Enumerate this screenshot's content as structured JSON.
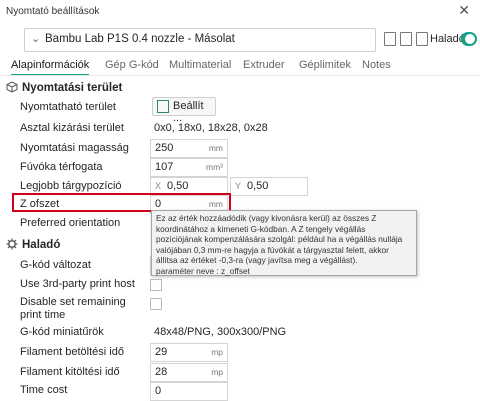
{
  "window": {
    "title": "Nyomtató beállítások",
    "close_glyph": "✕"
  },
  "preset": {
    "name": "Bambu Lab P1S 0.4 nozzle - Másolat",
    "advanced_label": "Haladó",
    "advanced_on": true
  },
  "tabs": [
    {
      "label": "Alapinformációk",
      "active": true
    },
    {
      "label": "Gép G-kód",
      "active": false
    },
    {
      "label": "Multimaterial",
      "active": false
    },
    {
      "label": "Extruder",
      "active": false
    },
    {
      "label": "Géplimitek",
      "active": false
    },
    {
      "label": "Notes",
      "active": false
    }
  ],
  "sections": {
    "printable_space": "Nyomtatási terület",
    "advanced": "Haladó"
  },
  "rows": {
    "printable_area": {
      "label": "Nyomtatható terület",
      "button": "Beállít ..."
    },
    "bed_exclude": {
      "label": "Asztal kizárási terület",
      "value": "0x0, 18x0, 18x28, 0x28"
    },
    "print_height": {
      "label": "Nyomtatási magasság",
      "value": "250",
      "unit": "mm"
    },
    "nozzle_volume": {
      "label": "Fúvóka térfogata",
      "value": "107",
      "unit": "mm³"
    },
    "best_position": {
      "label": "Legjobb tárgypozíció",
      "x_label": "X",
      "x_value": "0,50",
      "y_label": "Y",
      "y_value": "0,50"
    },
    "z_offset": {
      "label": "Z ofszet",
      "value": "0",
      "unit": "mm"
    },
    "preferred_orientation": {
      "label": "Preferred orientation"
    },
    "gcode_flavor": {
      "label": "G-kód változat"
    },
    "third_party_host": {
      "label": "Use 3rd-party print host"
    },
    "disable_remaining_time": {
      "label": "Disable set remaining print time"
    },
    "gcode_thumbnails": {
      "label": "G-kód miniatűrök",
      "value": "48x48/PNG, 300x300/PNG"
    },
    "filament_load_time": {
      "label": "Filament betöltési idő",
      "value": "29",
      "unit": "mp"
    },
    "filament_unload_time": {
      "label": "Filament kitöltési idő",
      "value": "28",
      "unit": "mp"
    },
    "time_cost": {
      "label": "Time cost",
      "value": "0"
    }
  },
  "tooltip": {
    "text": "Ez az érték hozzáadódik (vagy kivonásra kerül) az összes Z koordinátához a kimeneti G-kódban. A Z tengely végállás pozíciójának kompenzálására szolgál: például ha a végállás nullája valójában 0,3 mm-re hagyja a fúvókát a tárgyasztal felett, akkor állítsa az értéket -0,3-ra (vagy javítsa meg a végállást).",
    "param": "paraméter neve       : z_offset"
  },
  "colors": {
    "accent": "#16a085",
    "highlight": "#d0021b"
  }
}
